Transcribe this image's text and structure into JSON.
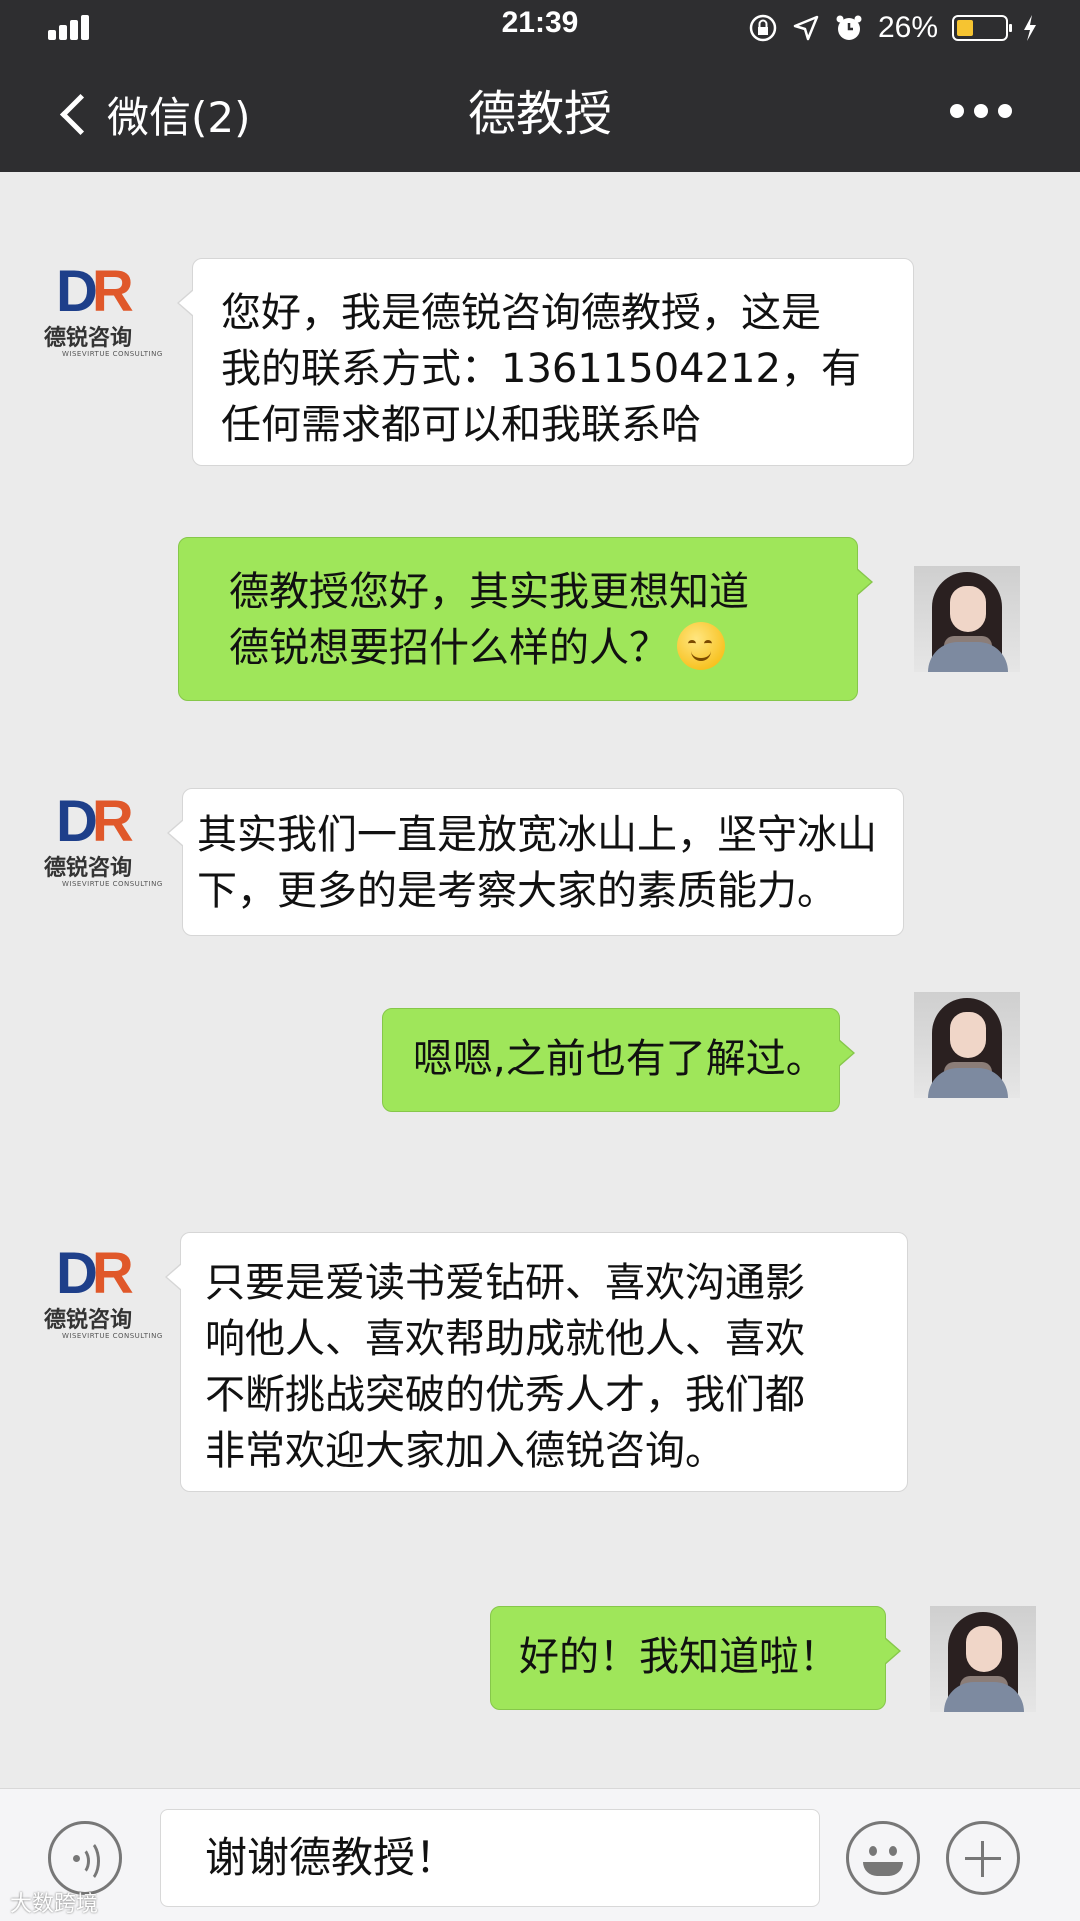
{
  "status_bar": {
    "time": "21:39",
    "battery_percent": "26%",
    "battery_level": 0.26,
    "icons": [
      "signal-bars-icon",
      "rotation-lock-icon",
      "location-arrow-icon",
      "alarm-clock-icon",
      "battery-icon",
      "charging-bolt-icon"
    ]
  },
  "nav": {
    "back_label": "微信(2)",
    "title": "德教授",
    "more_icon": "more-dots-icon"
  },
  "logo": {
    "letter_d": "D",
    "letter_r": "R",
    "chinese": "德锐咨询",
    "english": "WISEVIRTUE CONSULTING"
  },
  "messages": [
    {
      "sender": "other",
      "lines": [
        "您好，我是德锐咨询德教授，这是",
        "我的联系方式：13611504212，有",
        "任何需求都可以和我联系哈"
      ]
    },
    {
      "sender": "me",
      "lines": [
        "德教授您好，其实我更想知道",
        "德锐想要招什么样的人？"
      ],
      "emoji": "smiling-face-icon"
    },
    {
      "sender": "other",
      "lines": [
        "其实我们一直是放宽冰山上，坚守冰山",
        "下，更多的是考察大家的素质能力。"
      ]
    },
    {
      "sender": "me",
      "lines": [
        "嗯嗯,之前也有了解过。"
      ]
    },
    {
      "sender": "other",
      "lines": [
        "只要是爱读书爱钻研、喜欢沟通影",
        "响他人、喜欢帮助成就他人、喜欢",
        "不断挑战突破的优秀人才，我们都",
        "非常欢迎大家加入德锐咨询。"
      ]
    },
    {
      "sender": "me",
      "lines": [
        "好的！我知道啦！"
      ]
    }
  ],
  "input_bar": {
    "text": "谢谢德教授！",
    "voice_icon": "voice-input-icon",
    "emoji_icon": "emoji-icon",
    "plus_icon": "plus-icon"
  },
  "watermark": "大数跨境"
}
